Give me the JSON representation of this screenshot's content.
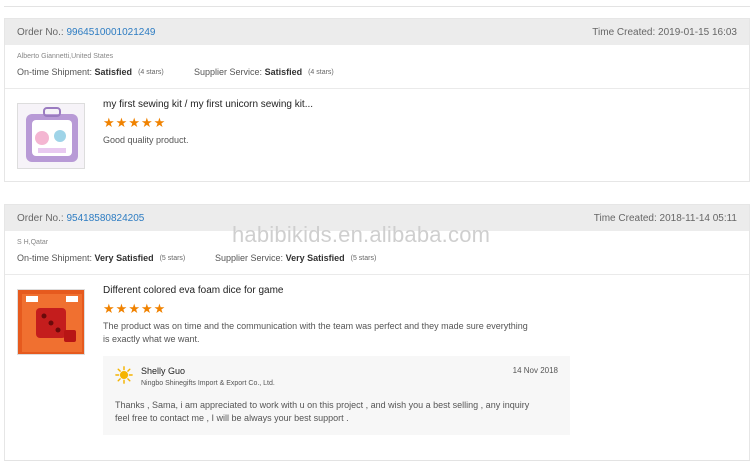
{
  "orders": [
    {
      "order_label": "Order No.:",
      "order_number": "9964510001021249",
      "time_created": "Time Created: 2019-01-15 16:03",
      "buyer": "Alberto Giannetti,United States",
      "shipment_label": "On-time Shipment:",
      "shipment_value": "Satisfied",
      "shipment_stars": "(4 stars)",
      "service_label": "Supplier Service:",
      "service_value": "Satisfied",
      "service_stars": "(4 stars)",
      "product_title": "my first sewing kit / my first unicorn sewing kit...",
      "rating": 5,
      "review_text": "Good quality product."
    },
    {
      "order_label": "Order No.:",
      "order_number": "95418580824205",
      "time_created": "Time Created: 2018-11-14 05:11",
      "buyer": "S H,Qatar",
      "shipment_label": "On-time Shipment:",
      "shipment_value": "Very Satisfied",
      "shipment_stars": "(5 stars)",
      "service_label": "Supplier Service:",
      "service_value": "Very Satisfied",
      "service_stars": "(5 stars)",
      "product_title": "Different colored eva foam dice for game",
      "rating": 5,
      "review_text_1": "The product was on time and the communication with the team was perfect and they made sure everything",
      "review_text_2": "is exactly what we want.",
      "reply": {
        "name": "Shelly Guo",
        "company": "Ningbo Shinegifts Import & Export Co., Ltd.",
        "date": "14 Nov 2018",
        "text_1": "Thanks , Sama, i am appreciated to work with u on this project , and  wish you a best selling , any inquiry",
        "text_2": "feel free to contact me , I will be always your best support ."
      }
    }
  ],
  "watermark": "habibikids.en.alibaba.com",
  "colors": {
    "link": "#2d7cc2",
    "star": "#f08200",
    "header_bg": "#ececec"
  },
  "icons": {
    "star": "star-icon",
    "sun": "sun-icon"
  }
}
